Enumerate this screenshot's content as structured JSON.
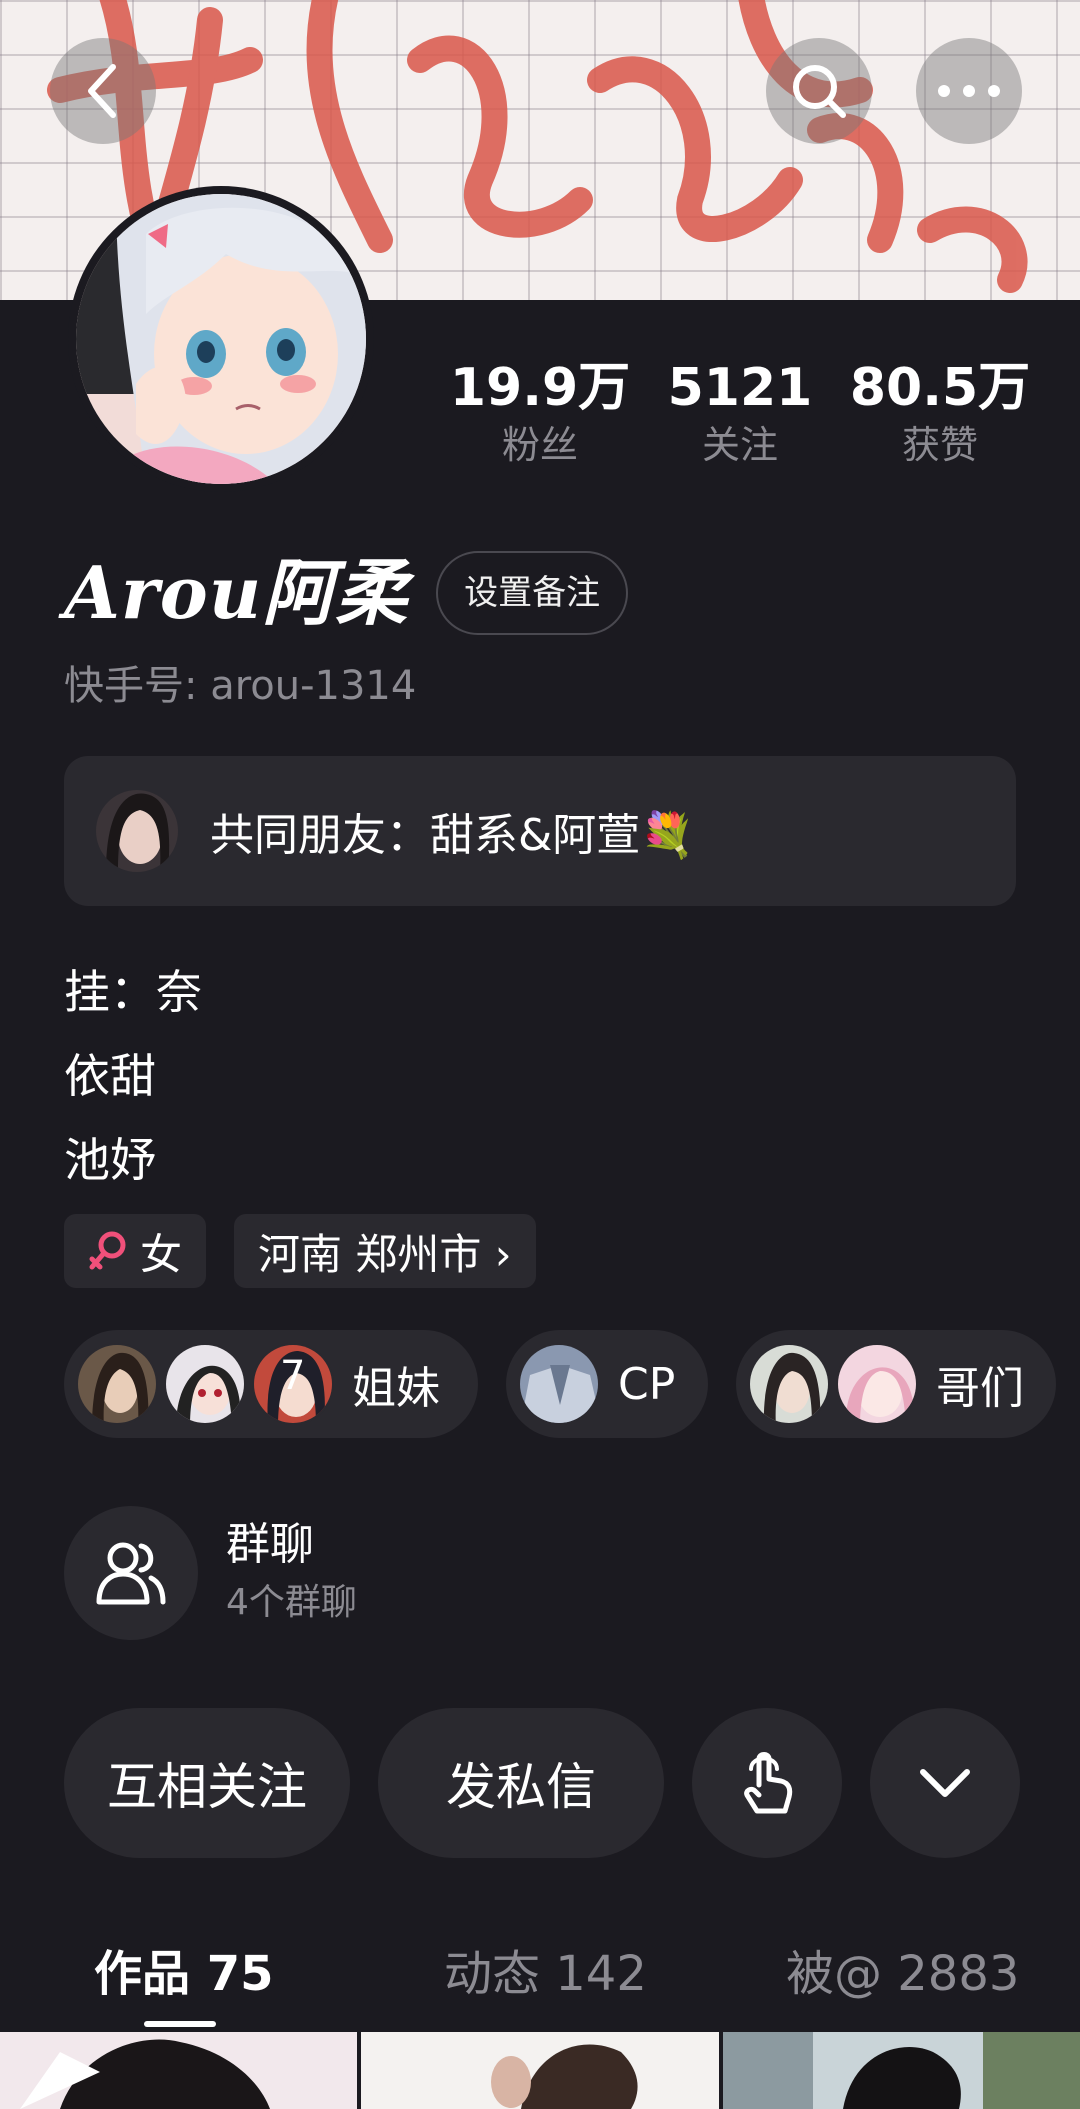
{
  "header": {
    "back_icon": "chevron-left-icon",
    "search_icon": "search-icon",
    "more_icon": "more-horizontal-icon"
  },
  "profile": {
    "name": "Arou阿柔",
    "remark_button": "设置备注",
    "kuaishou_id": "快手号: arou-1314"
  },
  "stats": [
    {
      "value": "19.9万",
      "label": "粉丝"
    },
    {
      "value": "5121",
      "label": "关注"
    },
    {
      "value": "80.5万",
      "label": "获赞"
    }
  ],
  "mutual_friends": {
    "text": "共同朋友：甜系&阿萱💐"
  },
  "bio": [
    "挂：奈",
    "依甜",
    "池妤"
  ],
  "tags": {
    "gender": "女",
    "location": "河南 郑州市 ›"
  },
  "relations": [
    {
      "label": "姐妹",
      "avatar_badge": "7"
    },
    {
      "label": "CP"
    },
    {
      "label": "哥们"
    }
  ],
  "group_chat": {
    "title": "群聊",
    "subtitle": "4个群聊"
  },
  "actions": {
    "mutual_follow": "互相关注",
    "message": "发私信"
  },
  "tabs": [
    {
      "label": "作品 75",
      "active": true
    },
    {
      "label": "动态 142",
      "active": false
    },
    {
      "label": "被@ 2883",
      "active": false
    }
  ],
  "colors": {
    "background": "#1b1a20",
    "card": "#2a292f",
    "muted_text": "#8c8b92",
    "female_icon": "#f0507a"
  }
}
